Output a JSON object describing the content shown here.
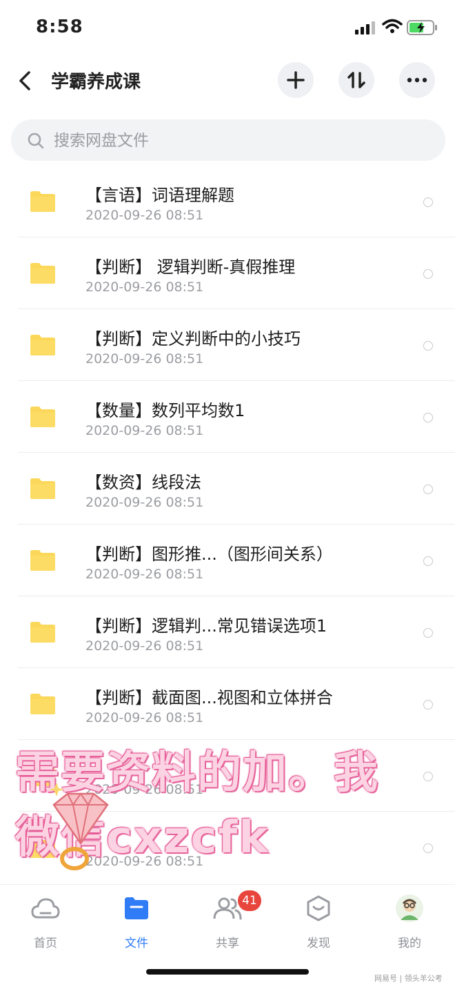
{
  "status_bar": {
    "time": "8:58"
  },
  "header": {
    "title": "学霸养成课"
  },
  "search": {
    "placeholder": "搜索网盘文件"
  },
  "files": [
    {
      "name": "【言语】词语理解题",
      "date": "2020-09-26 08:51"
    },
    {
      "name": "【判断】 逻辑判断-真假推理",
      "date": "2020-09-26 08:51"
    },
    {
      "name": "【判断】定义判断中的小技巧",
      "date": "2020-09-26 08:51"
    },
    {
      "name": "【数量】数列平均数1",
      "date": "2020-09-26 08:51"
    },
    {
      "name": "【数资】线段法",
      "date": "2020-09-26 08:51"
    },
    {
      "name": "【判断】图形推...（图形间关系）",
      "date": "2020-09-26 08:51"
    },
    {
      "name": "【判断】逻辑判...常见错误选项1",
      "date": "2020-09-26 08:51"
    },
    {
      "name": "【判断】截面图...视图和立体拼合",
      "date": "2020-09-26 08:51"
    },
    {
      "name": "",
      "date": "2020-09-26 08:51"
    },
    {
      "name": "",
      "date": "2020-09-26 08:51"
    }
  ],
  "overlay": {
    "line1": "需要资料的加。我",
    "line2": "微信cxzcfk"
  },
  "tabbar": {
    "home": "首页",
    "files": "文件",
    "share": "共享",
    "share_badge": "41",
    "discover": "发现",
    "mine": "我的"
  },
  "watermark": "网易号 | 领头羊公考",
  "colors": {
    "accent": "#2f7cf6",
    "folder": "#fbd85a",
    "badge": "#e8453c"
  }
}
